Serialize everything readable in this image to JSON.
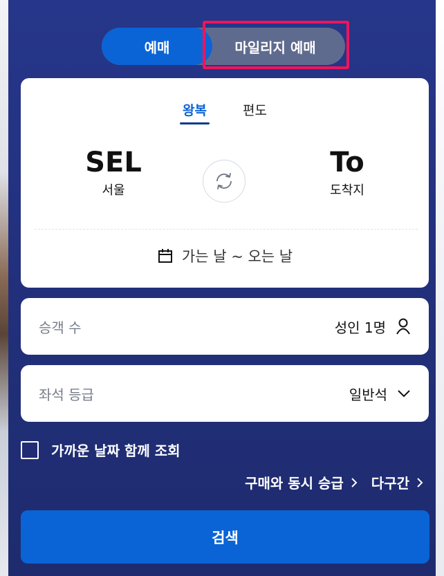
{
  "booking_toggle": {
    "active_label": "예매",
    "inactive_label": "마일리지 예매"
  },
  "trip_type": {
    "tabs": [
      "왕복",
      "편도"
    ]
  },
  "route": {
    "from_code": "SEL",
    "from_city": "서울",
    "to_code": "To",
    "to_city": "도착지"
  },
  "dates": {
    "label": "가는 날 ~ 오는 날"
  },
  "passengers": {
    "label": "승객 수",
    "value": "성인 1명"
  },
  "cabin_class": {
    "label": "좌석 등급",
    "value": "일반석"
  },
  "nearby_dates": {
    "label": "가까운 날짜 함께 조회"
  },
  "links": {
    "upgrade": "구매와 동시 승급",
    "multi_city": "다구간"
  },
  "search_button": {
    "label": "검색"
  },
  "colors": {
    "panel": "#22307c",
    "accent": "#0a64d6",
    "highlight": "#f0145a"
  }
}
